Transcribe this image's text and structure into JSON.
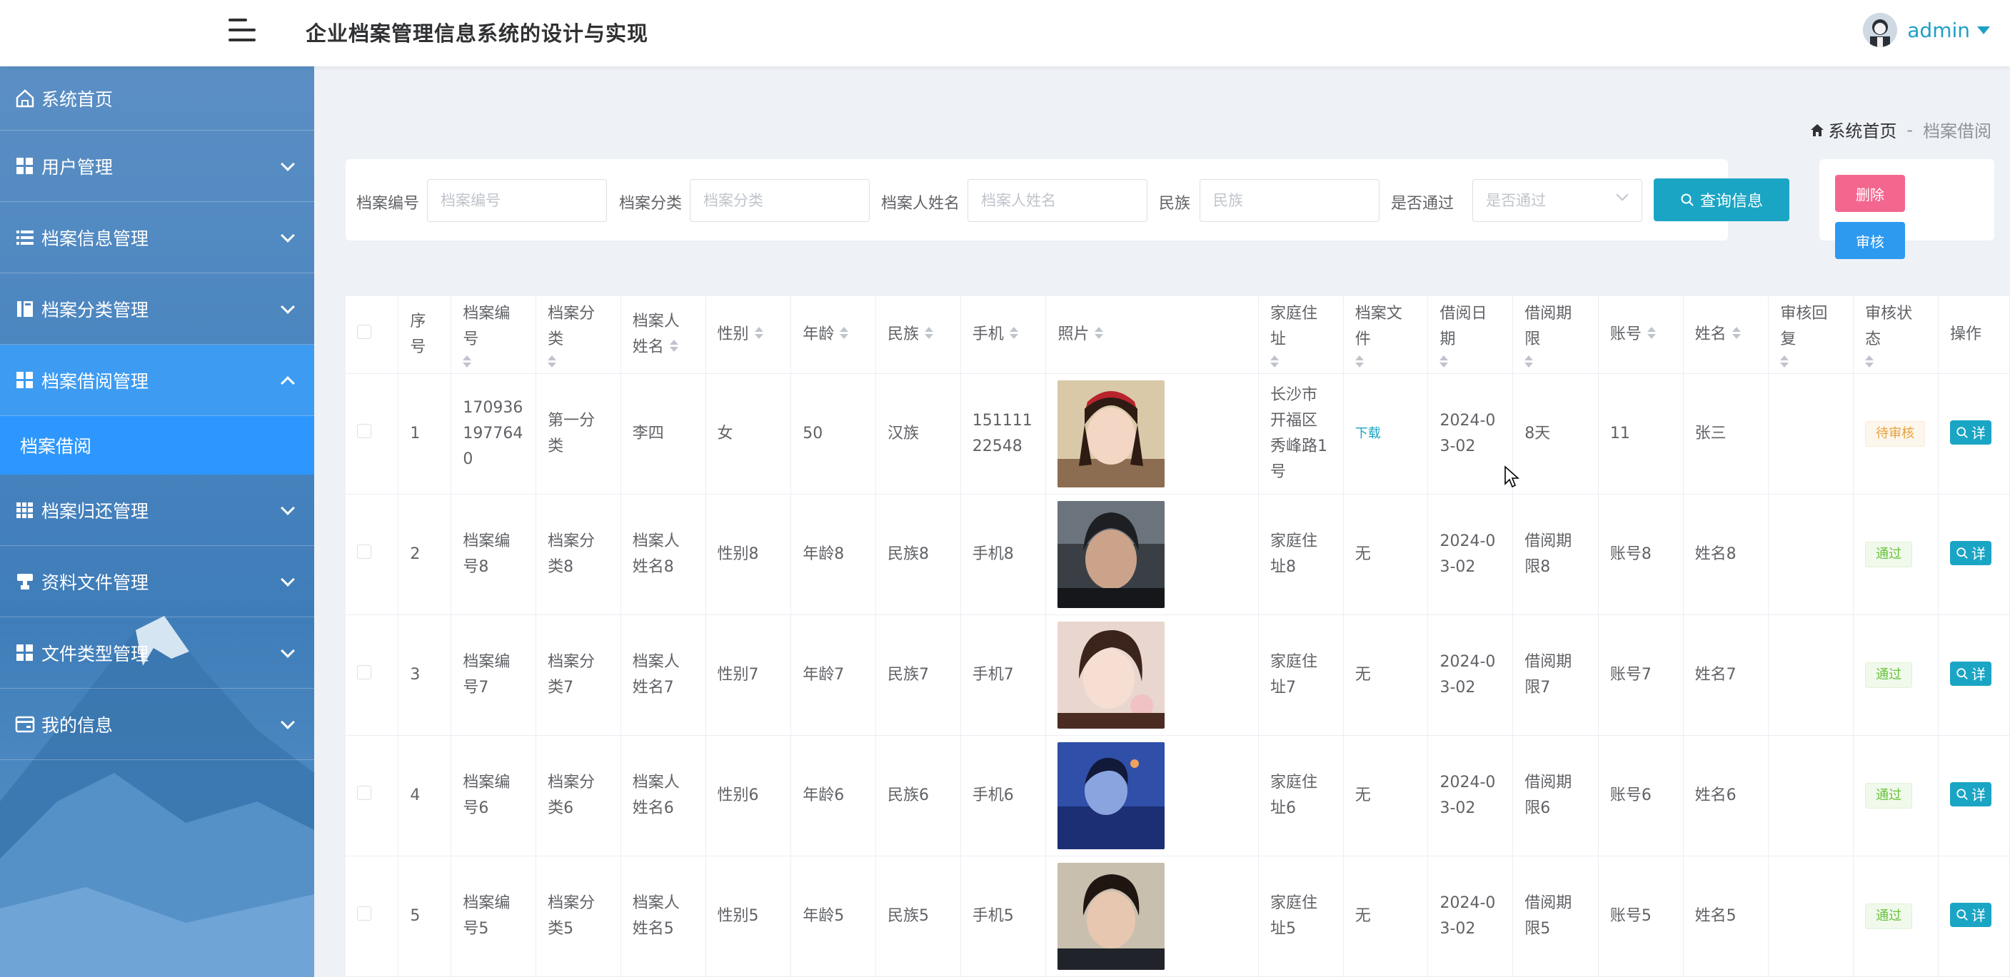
{
  "header": {
    "title": "企业档案管理信息系统的设计与实现",
    "user": "admin"
  },
  "sidebar": {
    "items": [
      {
        "label": "系统首页",
        "icon": "home-icon"
      },
      {
        "label": "用户管理",
        "icon": "grid-icon"
      },
      {
        "label": "档案信息管理",
        "icon": "list-icon"
      },
      {
        "label": "档案分类管理",
        "icon": "book-icon"
      },
      {
        "label": "档案借阅管理",
        "icon": "grid-icon"
      },
      {
        "label": "档案归还管理",
        "icon": "table-icon"
      },
      {
        "label": "资料文件管理",
        "icon": "stamp-icon"
      },
      {
        "label": "文件类型管理",
        "icon": "grid-icon"
      },
      {
        "label": "我的信息",
        "icon": "card-icon"
      }
    ],
    "submenu": {
      "label": "档案借阅"
    }
  },
  "breadcrumb": {
    "home": "系统首页",
    "sep": "-",
    "current": "档案借阅"
  },
  "search": {
    "fields": [
      {
        "label": "档案编号",
        "placeholder": "档案编号"
      },
      {
        "label": "档案分类",
        "placeholder": "档案分类"
      },
      {
        "label": "档案人姓名",
        "placeholder": "档案人姓名"
      },
      {
        "label": "民族",
        "placeholder": "民族"
      },
      {
        "label": "是否通过",
        "placeholder": "是否通过"
      }
    ],
    "query_label": "查询信息"
  },
  "actions": {
    "delete_label": "删除",
    "audit_label": "审核"
  },
  "table": {
    "headers": [
      "序号",
      "档案编号",
      "档案分类",
      "档案人姓名",
      "性别",
      "年龄",
      "民族",
      "手机",
      "照片",
      "家庭住址",
      "档案文件",
      "借阅日期",
      "借阅期限",
      "账号",
      "姓名",
      "审核回复",
      "审核状态",
      "操作"
    ],
    "rows": [
      {
        "no": "1",
        "code": "1709361977640",
        "category": "第一分类",
        "person": "李四",
        "gender": "女",
        "age": "50",
        "ethnic": "汉族",
        "phone": "15111122548",
        "address": "长沙市开福区秀峰路1号",
        "file": "下载",
        "date": "2024-03-02",
        "period": "8天",
        "account": "11",
        "name": "张三",
        "reply": "",
        "status": "待审核",
        "op": "详"
      },
      {
        "no": "2",
        "code": "档案编号8",
        "category": "档案分类8",
        "person": "档案人姓名8",
        "gender": "性别8",
        "age": "年龄8",
        "ethnic": "民族8",
        "phone": "手机8",
        "address": "家庭住址8",
        "file": "无",
        "date": "2024-03-02",
        "period": "借阅期限8",
        "account": "账号8",
        "name": "姓名8",
        "reply": "",
        "status": "通过",
        "op": "详"
      },
      {
        "no": "3",
        "code": "档案编号7",
        "category": "档案分类7",
        "person": "档案人姓名7",
        "gender": "性别7",
        "age": "年龄7",
        "ethnic": "民族7",
        "phone": "手机7",
        "address": "家庭住址7",
        "file": "无",
        "date": "2024-03-02",
        "period": "借阅期限7",
        "account": "账号7",
        "name": "姓名7",
        "reply": "",
        "status": "通过",
        "op": "详"
      },
      {
        "no": "4",
        "code": "档案编号6",
        "category": "档案分类6",
        "person": "档案人姓名6",
        "gender": "性别6",
        "age": "年龄6",
        "ethnic": "民族6",
        "phone": "手机6",
        "address": "家庭住址6",
        "file": "无",
        "date": "2024-03-02",
        "period": "借阅期限6",
        "account": "账号6",
        "name": "姓名6",
        "reply": "",
        "status": "通过",
        "op": "详"
      },
      {
        "no": "5",
        "code": "档案编号5",
        "category": "档案分类5",
        "person": "档案人姓名5",
        "gender": "性别5",
        "age": "年龄5",
        "ethnic": "民族5",
        "phone": "手机5",
        "address": "家庭住址5",
        "file": "无",
        "date": "2024-03-02",
        "period": "借阅期限5",
        "account": "账号5",
        "name": "姓名5",
        "reply": "",
        "status": "通过",
        "op": "详"
      }
    ]
  },
  "colors": {
    "accent": "#1ba5c4",
    "sidebar_active": "#3d9cf2",
    "delete": "#f3678f",
    "audit": "#2d9af0",
    "pending": "#e6a23c",
    "pass": "#67c23a"
  }
}
